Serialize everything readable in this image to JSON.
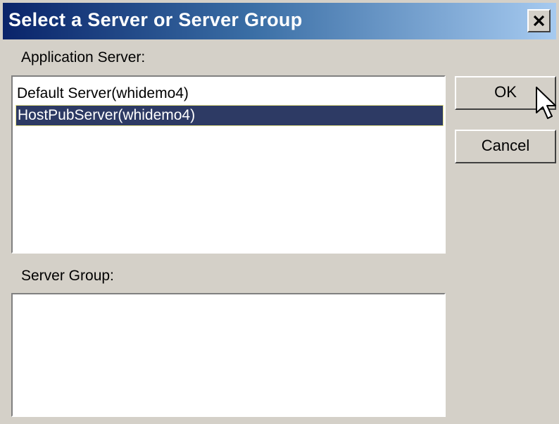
{
  "window": {
    "title": "Select a Server or Server Group",
    "close_icon": "close-icon"
  },
  "application_server": {
    "label": "Application Server:",
    "items": [
      {
        "label": "Default Server(whidemo4)",
        "selected": false
      },
      {
        "label": "HostPubServer(whidemo4)",
        "selected": true
      }
    ]
  },
  "server_group": {
    "label": "Server Group:",
    "items": []
  },
  "buttons": {
    "ok_label": "OK",
    "cancel_label": "Cancel"
  },
  "colors": {
    "selection_bg": "#2d3a64",
    "selection_focus_border": "#e8e48a",
    "dialog_bg": "#d4d0c8",
    "title_gradient_start": "#0a246a",
    "title_gradient_end": "#a6caf0"
  }
}
